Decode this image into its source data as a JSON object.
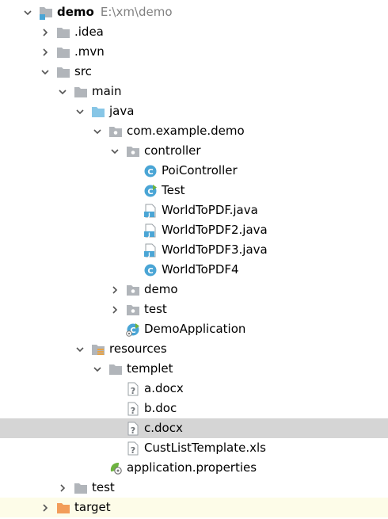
{
  "project_tree": {
    "rows": [
      {
        "label": "demo",
        "hint": "E:\\xm\\demo",
        "depth": 0,
        "arrow": "down",
        "icon": "module-folder-icon",
        "bold": true
      },
      {
        "label": ".idea",
        "depth": 1,
        "arrow": "right",
        "icon": "folder-icon"
      },
      {
        "label": ".mvn",
        "depth": 1,
        "arrow": "right",
        "icon": "folder-icon"
      },
      {
        "label": "src",
        "depth": 1,
        "arrow": "down",
        "icon": "folder-icon"
      },
      {
        "label": "main",
        "depth": 2,
        "arrow": "down",
        "icon": "folder-icon"
      },
      {
        "label": "java",
        "depth": 3,
        "arrow": "down",
        "icon": "source-root-icon"
      },
      {
        "label": "com.example.demo",
        "depth": 4,
        "arrow": "down",
        "icon": "package-icon"
      },
      {
        "label": "controller",
        "depth": 5,
        "arrow": "down",
        "icon": "package-icon"
      },
      {
        "label": "PoiController",
        "depth": 6,
        "arrow": "none",
        "icon": "class-icon"
      },
      {
        "label": "Test",
        "depth": 6,
        "arrow": "none",
        "icon": "runnable-class-icon"
      },
      {
        "label": "WorldToPDF.java",
        "depth": 6,
        "arrow": "none",
        "icon": "java-file-icon"
      },
      {
        "label": "WorldToPDF2.java",
        "depth": 6,
        "arrow": "none",
        "icon": "java-file-icon"
      },
      {
        "label": "WorldToPDF3.java",
        "depth": 6,
        "arrow": "none",
        "icon": "java-file-icon"
      },
      {
        "label": "WorldToPDF4",
        "depth": 6,
        "arrow": "none",
        "icon": "class-icon"
      },
      {
        "label": "demo",
        "depth": 5,
        "arrow": "right",
        "icon": "package-icon"
      },
      {
        "label": "test",
        "depth": 5,
        "arrow": "right",
        "icon": "package-icon"
      },
      {
        "label": "DemoApplication",
        "depth": 5,
        "arrow": "none",
        "icon": "spring-boot-class-icon"
      },
      {
        "label": "resources",
        "depth": 3,
        "arrow": "down",
        "icon": "resources-folder-icon"
      },
      {
        "label": "templet",
        "depth": 4,
        "arrow": "down",
        "icon": "folder-icon"
      },
      {
        "label": "a.docx",
        "depth": 5,
        "arrow": "none",
        "icon": "unknown-file-icon"
      },
      {
        "label": "b.doc",
        "depth": 5,
        "arrow": "none",
        "icon": "unknown-file-icon"
      },
      {
        "label": "c.docx",
        "depth": 5,
        "arrow": "none",
        "icon": "unknown-file-icon",
        "selected": true
      },
      {
        "label": "CustListTemplate.xls",
        "depth": 5,
        "arrow": "none",
        "icon": "unknown-file-icon"
      },
      {
        "label": "application.properties",
        "depth": 4,
        "arrow": "none",
        "icon": "spring-properties-icon"
      },
      {
        "label": "test",
        "depth": 2,
        "arrow": "right",
        "icon": "folder-icon"
      },
      {
        "label": "target",
        "depth": 1,
        "arrow": "right",
        "icon": "excluded-folder-icon",
        "highlight": true
      }
    ]
  },
  "colors": {
    "folder": "#b1b5ba",
    "source_root": "#87c6e6",
    "resources_marker": "#e8a447",
    "excluded_folder": "#f29d5a",
    "class_circle": "#4aa5d5",
    "spring_green": "#6db33f",
    "selected_row": "#d5d5d5",
    "highlight_row": "#fdfce8",
    "hint_text": "#808080"
  }
}
